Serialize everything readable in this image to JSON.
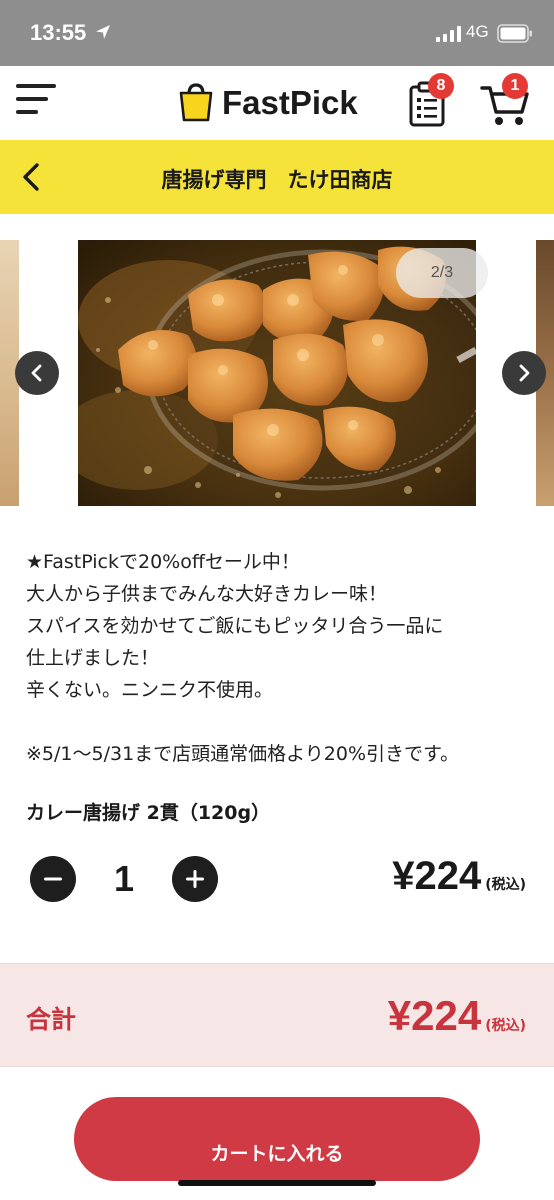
{
  "status_bar": {
    "time": "13:55",
    "network": "4G"
  },
  "header": {
    "logo_text": "FastPick",
    "list_badge": "8",
    "cart_badge": "1"
  },
  "shop": {
    "name": "唐揚げ専門　たけ田商店"
  },
  "carousel": {
    "counter": "2/3"
  },
  "description": {
    "lines": [
      "★FastPickで20%offセール中！",
      "大人から子供までみんな大好きカレー味！",
      "スパイスを効かせてご飯にもピッタリ合う一品に",
      "仕上げました！",
      "辛くない。ニンニク不使用。",
      "",
      "※5/1〜5/31まで店頭通常価格より20%引きです。"
    ]
  },
  "product": {
    "variant": "カレー唐揚げ 2貫（120g）",
    "quantity": "1",
    "price": "¥224",
    "tax_note": "(税込)"
  },
  "total": {
    "label": "合計",
    "price": "¥224",
    "tax_note": "(税込)"
  },
  "actions": {
    "add_to_cart": "カートに入れる"
  },
  "colors": {
    "accent_yellow": "#f6e33a",
    "accent_red": "#cf3a44",
    "badge_red": "#e53935",
    "total_bg": "#f7e6e6"
  }
}
